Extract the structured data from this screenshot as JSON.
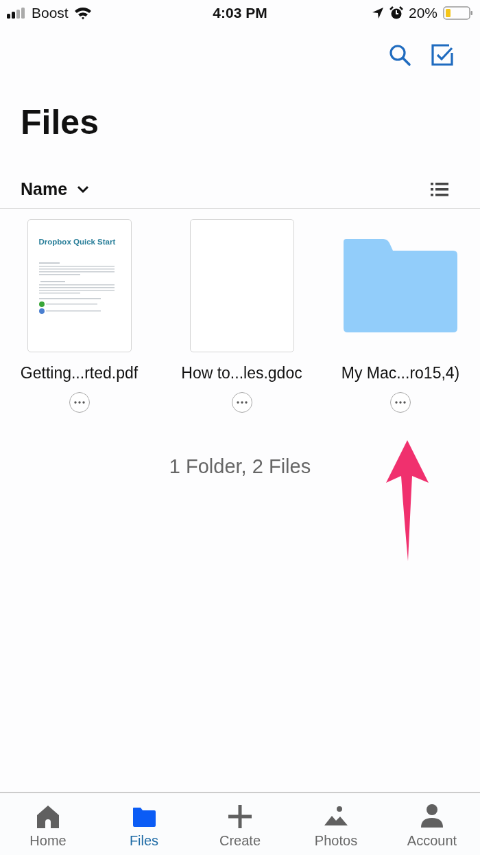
{
  "status_bar": {
    "carrier": "Boost",
    "time": "4:03 PM",
    "battery": "20%"
  },
  "title": "Files",
  "sort": {
    "label": "Name"
  },
  "items": [
    {
      "kind": "document",
      "name": "Getting...rted.pdf",
      "thumbnail_title": "Dropbox Quick Start"
    },
    {
      "kind": "blank",
      "name": "How to...les.gdoc"
    },
    {
      "kind": "folder",
      "name": "My Mac...ro15,4)"
    }
  ],
  "summary": "1 Folder, 2 Files",
  "annotation": {
    "kind": "arrow"
  },
  "tabs": [
    {
      "label": "Home",
      "kind": "home",
      "selected": false
    },
    {
      "label": "Files",
      "kind": "folder",
      "selected": true
    },
    {
      "label": "Create",
      "kind": "plus",
      "selected": false
    },
    {
      "label": "Photos",
      "kind": "photos",
      "selected": false
    },
    {
      "label": "Account",
      "kind": "person",
      "selected": false
    }
  ]
}
